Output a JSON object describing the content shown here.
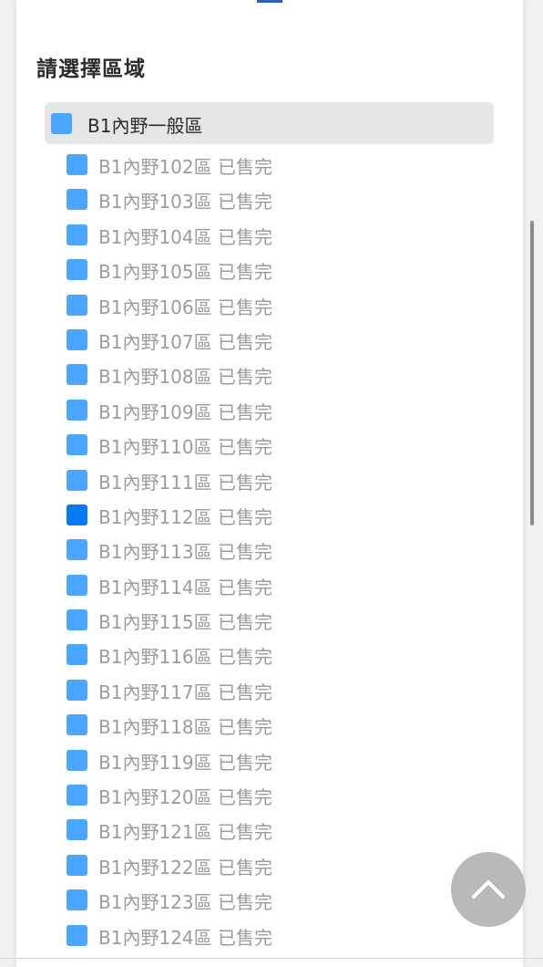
{
  "section": {
    "heading": "請選擇區域"
  },
  "group": {
    "label": "B1內野一般區"
  },
  "areas": [
    {
      "label": "B1內野102區 已售完"
    },
    {
      "label": "B1內野103區 已售完"
    },
    {
      "label": "B1內野104區 已售完"
    },
    {
      "label": "B1內野105區 已售完"
    },
    {
      "label": "B1內野106區 已售完"
    },
    {
      "label": "B1內野107區 已售完"
    },
    {
      "label": "B1內野108區 已售完"
    },
    {
      "label": "B1內野109區 已售完"
    },
    {
      "label": "B1內野110區 已售完"
    },
    {
      "label": "B1內野111區 已售完"
    },
    {
      "label": "B1內野112區 已售完",
      "selected": true
    },
    {
      "label": "B1內野113區 已售完"
    },
    {
      "label": "B1內野114區 已售完"
    },
    {
      "label": "B1內野115區 已售完"
    },
    {
      "label": "B1內野116區 已售完"
    },
    {
      "label": "B1內野117區 已售完"
    },
    {
      "label": "B1內野118區 已售完"
    },
    {
      "label": "B1內野119區 已售完"
    },
    {
      "label": "B1內野120區 已售完"
    },
    {
      "label": "B1內野121區 已售完"
    },
    {
      "label": "B1內野122區 已售完"
    },
    {
      "label": "B1內野123區 已售完"
    },
    {
      "label": "B1內野124區 已售完"
    }
  ],
  "colors": {
    "area_color": "#4ba6ff",
    "selected_area_color": "#0a78f0",
    "sold_out_text": "#9c9c9c",
    "group_header_bg": "#e6e6e6"
  },
  "icons": {
    "back_to_top": "chevron-up-icon"
  }
}
